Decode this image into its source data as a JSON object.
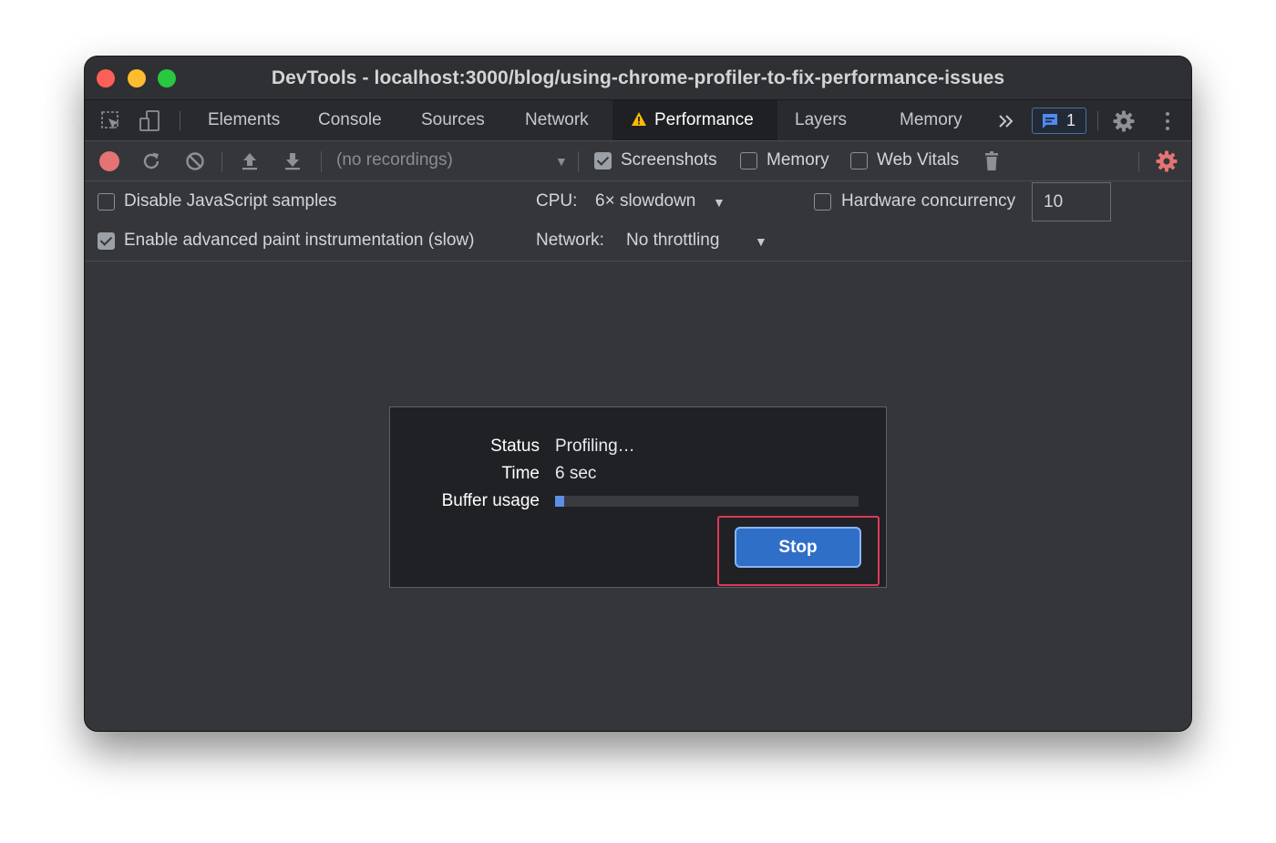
{
  "window": {
    "title": "DevTools - localhost:3000/blog/using-chrome-profiler-to-fix-performance-issues"
  },
  "tabs": [
    {
      "label": "Elements"
    },
    {
      "label": "Console"
    },
    {
      "label": "Sources"
    },
    {
      "label": "Network"
    },
    {
      "label": "Performance",
      "active": true,
      "icon": "warning-icon"
    },
    {
      "label": "Layers"
    },
    {
      "label": "Memory"
    }
  ],
  "tabbar": {
    "messages_count": "1"
  },
  "toolbar": {
    "recordings_select": "(no recordings)",
    "screenshots_label": "Screenshots",
    "screenshots_checked": true,
    "memory_label": "Memory",
    "memory_checked": false,
    "web_vitals_label": "Web Vitals",
    "web_vitals_checked": false
  },
  "settings": {
    "disable_js_samples_label": "Disable JavaScript samples",
    "disable_js_samples_checked": false,
    "advanced_paint_label": "Enable advanced paint instrumentation (slow)",
    "advanced_paint_checked": true,
    "cpu_label": "CPU:",
    "cpu_value": "6× slowdown",
    "network_label": "Network:",
    "network_value": "No throttling",
    "hardware_concurrency_label": "Hardware concurrency",
    "hardware_concurrency_checked": false,
    "hardware_concurrency_value": "10"
  },
  "dialog": {
    "status_label": "Status",
    "status_value": "Profiling…",
    "time_label": "Time",
    "time_value": "6 sec",
    "buffer_label": "Buffer usage",
    "buffer_usage_fraction": 0.03,
    "stop_label": "Stop"
  },
  "colors": {
    "record_active": "#e57373",
    "settings_gear_active": "#e57373",
    "stop_button": "#2f6fc8",
    "buffer_fill": "#5d8fe6",
    "highlight_border": "#dd3a5a"
  }
}
